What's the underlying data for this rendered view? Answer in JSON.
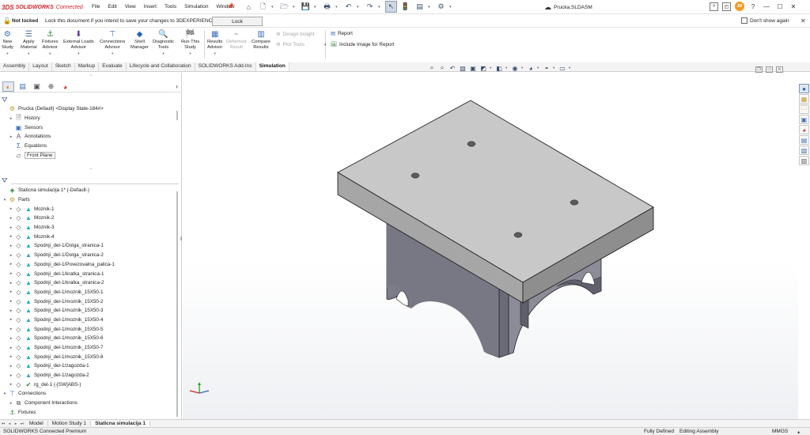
{
  "app": {
    "logo_ds": "3DS",
    "logo_name": "SOLIDWORKS",
    "logo_suffix": "Connected",
    "document_title": "Prucka.SLDASM",
    "user_initials": "JM"
  },
  "menu": [
    "File",
    "Edit",
    "View",
    "Insert",
    "Tools",
    "Simulation",
    "Window"
  ],
  "quick_access": [
    {
      "icon": "home-icon",
      "glyph": "⌂"
    },
    {
      "icon": "new-document-icon",
      "glyph": "🗋"
    },
    {
      "icon": "open-folder-icon",
      "glyph": "🗁"
    },
    {
      "icon": "save-icon",
      "glyph": "💾"
    },
    {
      "icon": "print-icon",
      "glyph": "🖶"
    },
    {
      "icon": "undo-icon",
      "glyph": "↶"
    },
    {
      "icon": "redo-icon",
      "glyph": "↷"
    },
    {
      "icon": "select-arrow-icon",
      "glyph": "↖"
    },
    {
      "icon": "rebuild-icon",
      "glyph": "🚦"
    },
    {
      "icon": "file-properties-icon",
      "glyph": "▤"
    },
    {
      "icon": "options-gear-icon",
      "glyph": "⚙"
    }
  ],
  "notice": {
    "status": "Not locked",
    "message": "Lock this document if you intend to save your changes to 3DEXPERIENCE.",
    "lock_button": "Lock",
    "dont_show_again": "Don't show again"
  },
  "ribbon": {
    "buttons": [
      {
        "id": "new-study",
        "label": [
          "New",
          "Study"
        ],
        "glyph": "⚙",
        "color": "#3c6fb6",
        "disabled": false,
        "dropdown": true
      },
      {
        "id": "apply-material",
        "label": [
          "Apply",
          "Material"
        ],
        "glyph": "☰",
        "color": "#4b6fa3",
        "disabled": false,
        "dropdown": true
      },
      {
        "id": "fixtures-advisor",
        "label": [
          "Fixtures",
          "Advisor"
        ],
        "glyph": "⚓",
        "color": "#2f8a3a",
        "disabled": false,
        "dropdown": true
      },
      {
        "id": "external-loads-advisor",
        "label": [
          "External Loads",
          "Advisor"
        ],
        "glyph": "⬇",
        "color": "#5a2fa3",
        "disabled": false,
        "dropdown": true
      },
      {
        "id": "connections-advisor",
        "label": [
          "Connections",
          "Advisor"
        ],
        "glyph": "⊤",
        "color": "#3c6fb6",
        "disabled": false,
        "dropdown": true
      },
      {
        "id": "shell-manager",
        "label": [
          "Shell",
          "Manager"
        ],
        "glyph": "◆",
        "color": "#2b63b0",
        "disabled": false,
        "dropdown": false
      },
      {
        "id": "diagnostic-tools",
        "label": [
          "Diagnostic",
          "Tools"
        ],
        "glyph": "🔍",
        "color": "#3c6fb6",
        "disabled": false,
        "dropdown": true
      },
      {
        "id": "run-this-study",
        "label": [
          "Run This",
          "Study"
        ],
        "glyph": "🏁",
        "color": "#2f8a3a",
        "disabled": false,
        "dropdown": true
      },
      {
        "id": "results-advisor",
        "label": [
          "Results",
          "Advisor"
        ],
        "glyph": "▦",
        "color": "#3c6fb6",
        "disabled": false,
        "dropdown": true
      },
      {
        "id": "deformed-result",
        "label": [
          "Deformed",
          "Result"
        ],
        "glyph": "⌁",
        "color": "#a7a7a7",
        "disabled": true,
        "dropdown": false
      },
      {
        "id": "compare-results",
        "label": [
          "Compare",
          "Results"
        ],
        "glyph": "▥",
        "color": "#3c6fb6",
        "disabled": false,
        "dropdown": false
      }
    ],
    "small_disabled": [
      "Design Insight",
      "Plot Tools"
    ],
    "small_enabled": [
      "Report",
      "Include Image for Report"
    ]
  },
  "command_tabs": [
    "Assembly",
    "Layout",
    "Sketch",
    "Markup",
    "Evaluate",
    "Lifecycle and Collaboration",
    "SOLIDWORKS Add-Ins",
    "Simulation"
  ],
  "active_command_tab": "Simulation",
  "feature_tree": {
    "root": "Prucka (Default) <Display State-184#>",
    "items": [
      "History",
      "Sensors",
      "Annotations",
      "Equations",
      "Front Plane"
    ]
  },
  "sim_tree": {
    "study": "Staticna simulacija 1* (-Default-)",
    "parts_label": "Parts",
    "parts": [
      "Moznik-1",
      "Moznik-2",
      "Moznik-3",
      "Moznik-4",
      "Spodnji_del-1/Dolga_stranica-1",
      "Spodnji_del-1/Dolga_stranica-2",
      "Spodnji_del-1/Povezovalna_palica-1",
      "Spodnji_del-1/kratka_stranica-1",
      "Spodnji_del-1/kratka_stranica-2",
      "Spodnji_del-1/moznik_15X50-1",
      "Spodnji_del-1/moznik_15X50-2",
      "Spodnji_del-1/moznik_15X50-3",
      "Spodnji_del-1/moznik_15X50-4",
      "Spodnji_del-1/moznik_15X50-5",
      "Spodnji_del-1/moznik_15X50-6",
      "Spodnji_del-1/moznik_15X50-7",
      "Spodnji_del-1/moznik_15X50-8",
      "Spodnji_del-1/zagozda-1",
      "Spodnji_del-1/zagozda-2"
    ],
    "last_part": "rg_del-1 (-[SW]ABS-)",
    "connections_label": "Connections",
    "component_interactions": "Component Interactions",
    "fixtures_label": "Fixtures"
  },
  "bottom_tabs": [
    "Model",
    "Motion Study 1",
    "Staticna simulacija 1"
  ],
  "active_bottom_tab": "Staticna simulacija 1",
  "status": {
    "product": "SOLIDWORKS Connected Premium",
    "definition": "Fully Defined",
    "mode": "Editing Assembly",
    "units": "MMGS"
  },
  "colors": {
    "brand_red": "#d3222a",
    "top_face": "#c9c9c9",
    "front_face": "#a9a9a9",
    "right_face": "#8d8d8d",
    "base_dark": "#6f6f79",
    "base_mid": "#8f8f99"
  }
}
